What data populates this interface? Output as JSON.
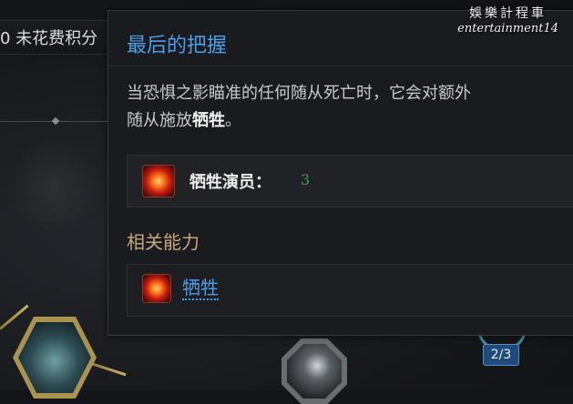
{
  "background": {
    "unspent_points_text": "0 未花费积分",
    "rank_badge": "2/3"
  },
  "tooltip": {
    "title": "最后的把握",
    "description_prefix": "当恐惧之影瞄准的任何随从死亡时，它会对额外",
    "description_line2_prefix": "随从施放",
    "description_keyword": "牺牲",
    "description_suffix": "。",
    "stat": {
      "label": "牺牲演员：",
      "value": "3",
      "icon": "sacrifice-icon"
    },
    "related_section_title": "相关能力",
    "related_ability": {
      "label": "牺牲",
      "icon": "sacrifice-icon"
    }
  },
  "watermark": {
    "chinese": "娛樂計程車",
    "english": "entertainment14"
  },
  "colors": {
    "title_blue": "#4c9ee8",
    "section_tan": "#c7a77a",
    "stat_green": "#3fa34a"
  }
}
